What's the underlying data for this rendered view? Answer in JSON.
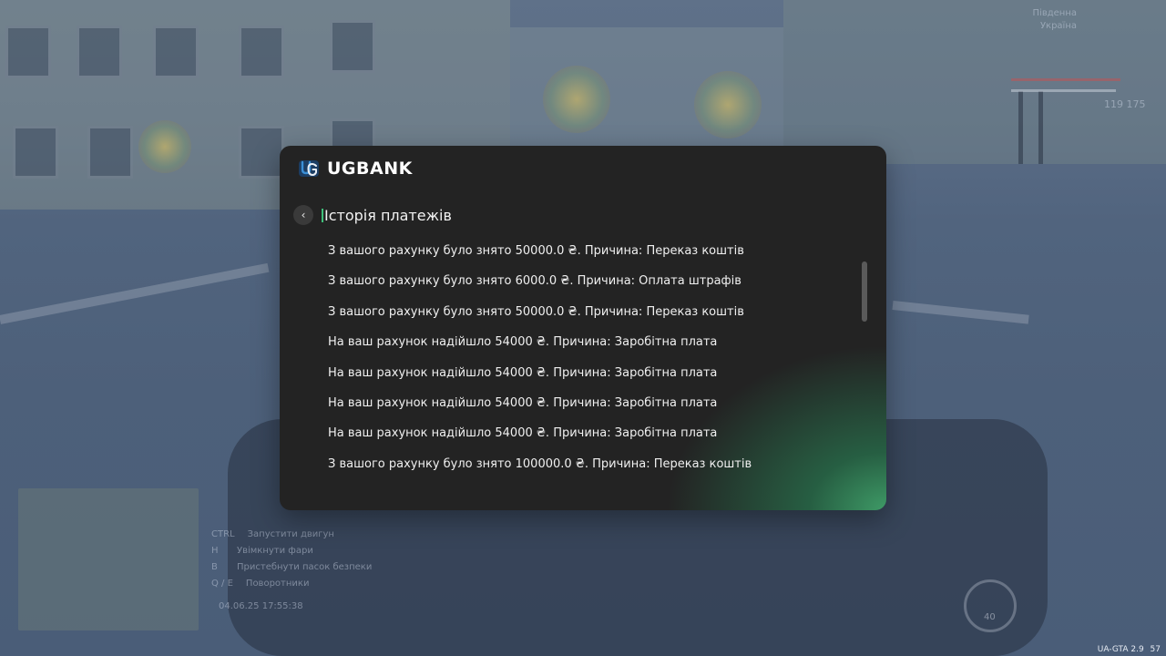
{
  "bank": {
    "brand": "UGBANK",
    "logo_icon": "ugbank-logo-icon",
    "back_icon": "chevron-left-icon",
    "title": "Історія платежів",
    "history": [
      "З вашого рахунку було знято 50000.0 ₴. Причина: Переказ коштів",
      "З вашого рахунку було знято 6000.0 ₴. Причина: Оплата штрафів",
      "З вашого рахунку було знято 50000.0 ₴. Причина: Переказ коштів",
      "На ваш рахунок надійшло 54000 ₴. Причина: Заробітна плата",
      "На ваш рахунок надійшло 54000 ₴. Причина: Заробітна плата",
      "На ваш рахунок надійшло 54000 ₴. Причина: Заробітна плата",
      "На ваш рахунок надійшло 54000 ₴. Причина: Заробітна плата",
      "З вашого рахунку було знято 100000.0 ₴. Причина: Переказ коштів"
    ],
    "colors": {
      "panel": "#232323",
      "accent_green": "#3e9a66",
      "text": "#f0f0f0",
      "logo_blue": "#3b8fd6"
    }
  },
  "hud": {
    "hints": [
      {
        "key": "CTRL",
        "label": "Запустити двигун"
      },
      {
        "key": "H",
        "label": "Увімкнути фари"
      },
      {
        "key": "B",
        "label": "Пристебнути пасок безпеки"
      },
      {
        "key": "Q / E",
        "label": "Поворотники"
      }
    ],
    "datetime": "04.06.25 17:55:38",
    "location_top": "Південна",
    "location_sub": "Україна",
    "money": "119 175",
    "speed": "40",
    "version": "UA-GTA 2.9",
    "version_extra": "57"
  }
}
